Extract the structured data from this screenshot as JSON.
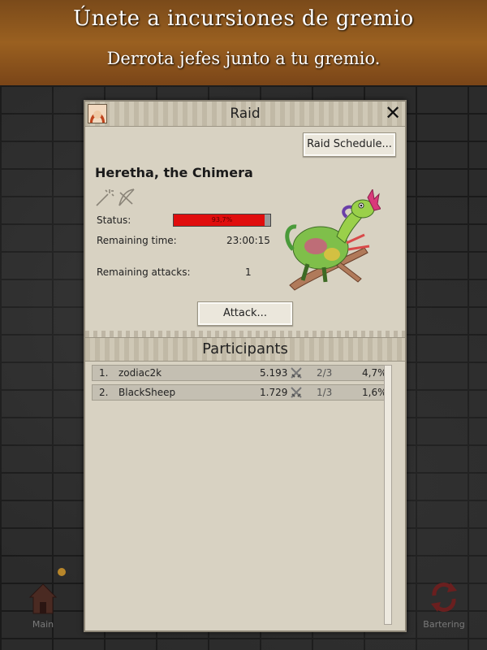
{
  "banner": {
    "title": "Únete a incursiones de gremio",
    "subtitle": "Derrota jefes junto a tu gremio."
  },
  "bottom_nav": {
    "main_label": "Main",
    "bartering_label": "Bartering"
  },
  "dialog": {
    "title": "Raid",
    "close_symbol": "✕",
    "raid_schedule_label": "Raid Schedule...",
    "boss_name": "Heretha, the Chimera",
    "class_icons": [
      "magic-wand-icon",
      "bow-icon"
    ],
    "status_label": "Status:",
    "status_percent_text": "93,7%",
    "status_fraction": 0.937,
    "remaining_time_label": "Remaining time:",
    "remaining_time_value": "23:00:15",
    "remaining_attacks_label": "Remaining attacks:",
    "remaining_attacks_value": "1",
    "attack_label": "Attack...",
    "participants_title": "Participants",
    "participants": [
      {
        "rank": "1.",
        "name": "zodiac2k",
        "damage": "5.193",
        "attacks": "2/3",
        "percent": "4,7%"
      },
      {
        "rank": "2.",
        "name": "BlackSheep",
        "damage": "1.729",
        "attacks": "1/3",
        "percent": "1,6%"
      }
    ]
  },
  "colors": {
    "banner": "#9a6020",
    "hp_fill": "#e00d0d",
    "panel": "#d8d2c2"
  }
}
